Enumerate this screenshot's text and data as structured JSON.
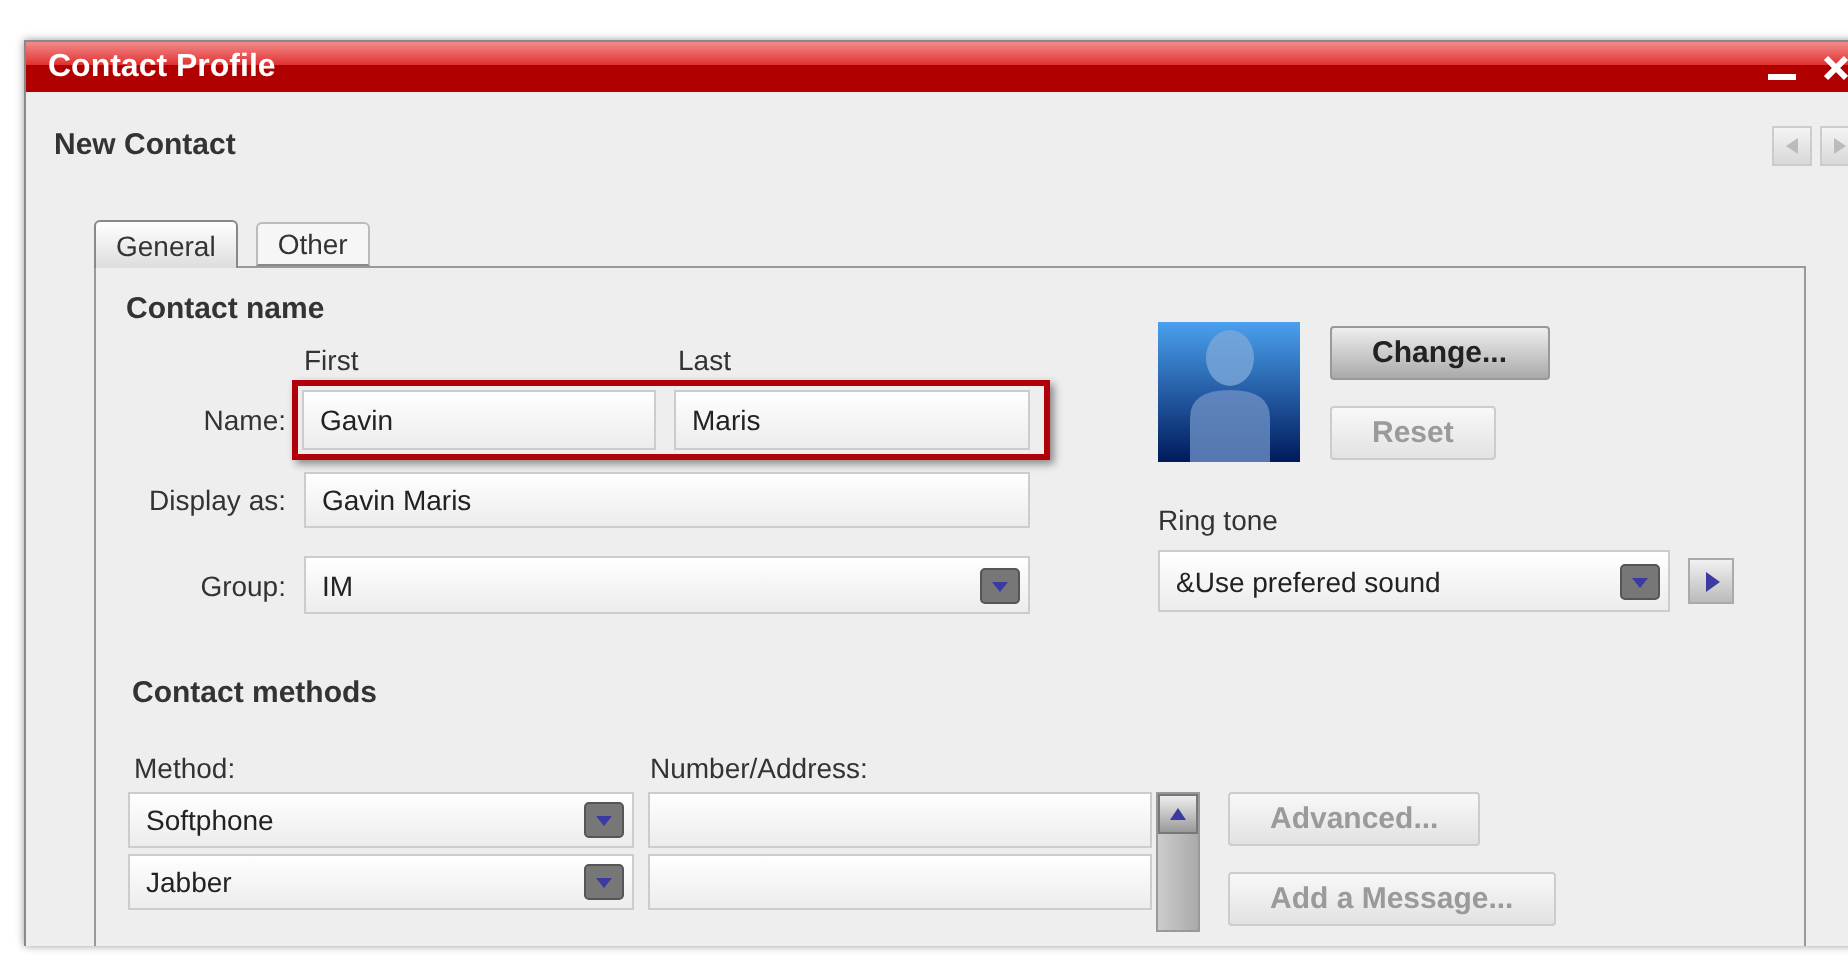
{
  "window": {
    "title": "Contact Profile"
  },
  "header": {
    "title": "New Contact"
  },
  "tabs": [
    {
      "label": "General",
      "selected": true
    },
    {
      "label": "Other",
      "selected": false
    }
  ],
  "contact_name": {
    "heading": "Contact name",
    "first_label": "First",
    "last_label": "Last",
    "name_label": "Name:",
    "first": "Gavin",
    "last": "Maris",
    "highlighted": true,
    "display_label": "Display as:",
    "display": "Gavin Maris",
    "group_label": "Group:",
    "group": "IM"
  },
  "photo_buttons": [
    {
      "label": "Change...",
      "disabled": false
    },
    {
      "label": "Reset",
      "disabled": true
    }
  ],
  "ring_tone": {
    "label": "Ring tone",
    "value": "&Use prefered sound"
  },
  "contact_methods": {
    "heading": "Contact methods",
    "method_label": "Method:",
    "address_label": "Number/Address:",
    "rows": [
      {
        "method": "Softphone"
      },
      {
        "method": "Jabber"
      }
    ],
    "buttons": [
      {
        "label": "Advanced...",
        "disabled": true
      },
      {
        "label": "Add a Message...",
        "disabled": true
      }
    ]
  }
}
